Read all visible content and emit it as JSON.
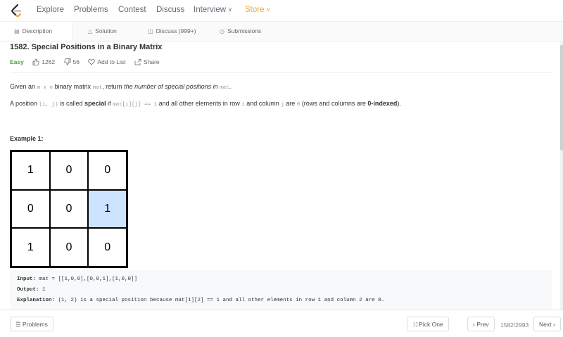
{
  "nav": {
    "items": [
      "Explore",
      "Problems",
      "Contest",
      "Discuss",
      "Interview",
      "Store"
    ]
  },
  "tabs": [
    {
      "label": "Description",
      "icon": "description-icon"
    },
    {
      "label": "Solution",
      "icon": "flask-icon"
    },
    {
      "label": "Discuss (999+)",
      "icon": "discuss-icon"
    },
    {
      "label": "Submissions",
      "icon": "history-icon"
    }
  ],
  "problem": {
    "title": "1582. Special Positions in a Binary Matrix",
    "difficulty": "Easy",
    "likes": "1262",
    "dislikes": "56",
    "add_to_list": "Add to List",
    "share": "Share",
    "difficulty_color": "#43a047"
  },
  "desc1": {
    "p1": "Given an ",
    "c1": "m x n",
    "p2": " binary matrix ",
    "c2": "mat",
    "p3": ", return ",
    "em": "the number of special positions in ",
    "c3": "mat",
    "p4": "."
  },
  "desc2": {
    "p1": "A position ",
    "c1": "(i, j)",
    "p2": " is called ",
    "s1": "special",
    "p3": " if ",
    "c2": "mat[i][j] == 1",
    "p4": " and all other elements in row ",
    "c3": "i",
    "p5": " and column ",
    "c4": "j",
    "p6": " are ",
    "c5": "0",
    "p7": " (rows and columns are ",
    "s2": "0-indexed",
    "p8": ")."
  },
  "example": {
    "title": "Example 1:",
    "matrix": [
      [
        "1",
        "0",
        "0"
      ],
      [
        "0",
        "0",
        "1"
      ],
      [
        "1",
        "0",
        "0"
      ]
    ],
    "highlight_color": "#cce4ff",
    "input_label": "Input:",
    "input_value": " mat = [[1,0,0],[0,0,1],[1,0,0]]",
    "output_label": "Output:",
    "output_value": " 1",
    "explanation_label": "Explanation:",
    "explanation_value": " (1, 2) is a special position because mat[1][2] == 1 and all other elements in row 1 and column 2 are 0."
  },
  "bottom": {
    "problems": "Problems",
    "pick_one": "Pick One",
    "prev": "Prev",
    "counter": "1582/2993",
    "next": "Next"
  }
}
